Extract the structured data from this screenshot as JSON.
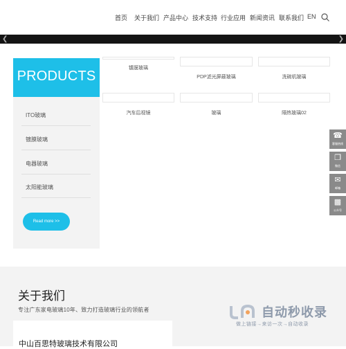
{
  "nav": {
    "items": [
      "首页",
      "关于我们",
      "产品中心",
      "技术支持",
      "行业应用",
      "新闻资讯",
      "联系我们",
      "EN"
    ]
  },
  "sidebar": {
    "title": "PRODUCTS",
    "items": [
      "ITO玻璃",
      "镀膜玻璃",
      "电器玻璃",
      "太阳能玻璃"
    ],
    "read_more": "Read more >>"
  },
  "products": {
    "row1": [
      "镀膜玻璃",
      "PDP滤光屏蔽玻璃",
      "洗碗机玻璃"
    ],
    "row2": [
      "汽车后视镜",
      "玻璃",
      "隔热玻璃02"
    ]
  },
  "about": {
    "title": "关于我们",
    "subtitle": "专注广东家电玻璃10年、致力打造玻璃行业的领航者",
    "company": "中山百思特玻璃技术有限公司"
  },
  "toolbar": {
    "items": [
      "客服热线",
      "微信",
      "邮箱",
      "公众号"
    ]
  },
  "watermark": {
    "text": "自动秒收录",
    "slogan": "做上链接→来访一次→自动收录"
  },
  "colors": {
    "accent": "#1ebfe8",
    "banner": "#141414",
    "toolbar": "#8a8a8a",
    "panel": "#f3f3f3"
  }
}
